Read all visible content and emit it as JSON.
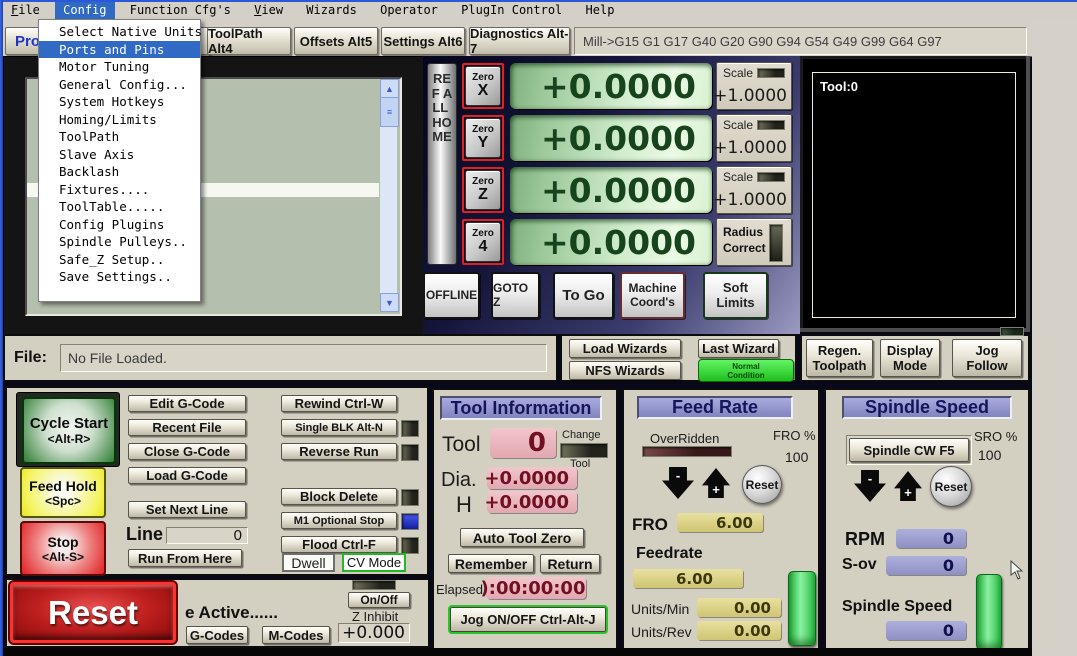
{
  "menubar": {
    "items": [
      "File",
      "Config",
      "Function Cfg's",
      "View",
      "Wizards",
      "Operator",
      "PlugIn Control",
      "Help"
    ]
  },
  "config_menu": {
    "highlighted_item": "Ports and Pins",
    "items": [
      "Select Native Units",
      "Ports and Pins",
      "Motor Tuning",
      "General Config...",
      "System Hotkeys",
      "Homing/Limits",
      "ToolPath",
      "Slave Axis",
      "Backlash",
      "Fixtures....",
      "ToolTable.....",
      "Config Plugins",
      "Spindle Pulleys..",
      "Safe_Z Setup..",
      "Save Settings.."
    ]
  },
  "tabbar": {
    "program_tab": "Prog",
    "toolpath_tab": "ToolPath Alt4",
    "offsets_tab": "Offsets Alt5",
    "settings_tab": "Settings Alt6",
    "diagnostics_tab": "Diagnostics Alt-7",
    "gcode_status": "Mill->G15  G1 G17 G40 G20 G90 G94 G54 G49 G99 G64 G97"
  },
  "toolpath_display": {
    "tool_readout": "Tool:0"
  },
  "dro": {
    "ref_all_home": "REF ALL HOME",
    "zero_label": "Zero",
    "axes": [
      {
        "letter": "X",
        "value": "+0.0000",
        "scale_label": "Scale",
        "scale_value": "+1.0000"
      },
      {
        "letter": "Y",
        "value": "+0.0000",
        "scale_label": "Scale",
        "scale_value": "+1.0000"
      },
      {
        "letter": "Z",
        "value": "+0.0000",
        "scale_label": "Scale",
        "scale_value": "+1.0000"
      },
      {
        "letter": "4",
        "value": "+0.0000"
      }
    ],
    "radius_correct_line1": "Radius",
    "radius_correct_line2": "Correct",
    "offline_btn": "OFFLINE",
    "goto_z_btn": "GOTO Z",
    "to_go_btn": "To Go",
    "machine_coords_line1": "Machine",
    "machine_coords_line2": "Coord's",
    "soft_limits_line1": "Soft",
    "soft_limits_line2": "Limits"
  },
  "file_bar": {
    "label": "File:",
    "filename": "No File Loaded."
  },
  "wizards": {
    "load_btn": "Load Wizards",
    "last_btn": "Last Wizard",
    "nfs_btn": "NFS Wizards",
    "normal_line1": "Normal",
    "normal_line2": "Condition"
  },
  "view_controls": {
    "regen_line1": "Regen.",
    "regen_line2": "Toolpath",
    "display_line1": "Display",
    "display_line2": "Mode",
    "jog_line1": "Jog",
    "jog_line2": "Follow"
  },
  "run_panel": {
    "cycle_start_line1": "Cycle Start",
    "cycle_start_line2": "<Alt-R>",
    "feed_hold_line1": "Feed Hold",
    "feed_hold_line2": "<Spc>",
    "stop_line1": "Stop",
    "stop_line2": "<Alt-S>",
    "edit_gcode": "Edit G-Code",
    "recent_file": "Recent File",
    "close_gcode": "Close G-Code",
    "load_gcode": "Load G-Code",
    "set_next_line": "Set Next Line",
    "line_label": "Line",
    "line_value": "0",
    "run_from_here": "Run From Here",
    "rewind": "Rewind Ctrl-W",
    "single_blk": "Single BLK Alt-N",
    "reverse_run": "Reverse Run",
    "block_delete": "Block Delete",
    "m1_optional_stop": "M1 Optional Stop",
    "flood": "Flood Ctrl-F",
    "dwell": "Dwell",
    "cv_mode": "CV Mode"
  },
  "reset_panel": {
    "reset": "Reset",
    "active_text": "e Active......",
    "gcodes_btn": "G-Codes",
    "mcodes_btn": "M-Codes",
    "onoff_btn": "On/Off",
    "z_inhibit_label": "Z Inhibit",
    "z_inhibit_value": "+0.000"
  },
  "tool_info": {
    "title": "Tool Information",
    "tool_label": "Tool",
    "tool_value": "0",
    "change_label": "Change",
    "tool_sub_label": "Tool",
    "dia_label": "Dia.",
    "dia_value": "+0.0000",
    "h_label": "H",
    "h_value": "+0.0000",
    "auto_tool_zero": "Auto Tool Zero",
    "remember_btn": "Remember",
    "return_btn": "Return",
    "elapsed_label": "Elapsed",
    "elapsed_value": "):00:00:00",
    "jog_btn": "Jog ON/OFF Ctrl-Alt-J"
  },
  "feed_rate": {
    "title": "Feed Rate",
    "overridden_label": "OverRidden",
    "fro_pct_label": "FRO %",
    "fro_pct_value": "100",
    "minus": "-",
    "plus": "+",
    "reset_btn": "Reset",
    "fro_label": "FRO",
    "fro_value": "6.00",
    "feedrate_label": "Feedrate",
    "feedrate_value": "6.00",
    "units_min_label": "Units/Min",
    "units_min_value": "0.00",
    "units_rev_label": "Units/Rev",
    "units_rev_value": "0.00"
  },
  "spindle": {
    "title": "Spindle Speed",
    "cw_btn": "Spindle CW F5",
    "sro_pct_label": "SRO %",
    "sro_pct_value": "100",
    "minus": "-",
    "plus": "+",
    "reset_btn": "Reset",
    "rpm_label": "RPM",
    "rpm_value": "0",
    "sov_label": "S-ov",
    "sov_value": "0",
    "speed_label": "Spindle Speed",
    "speed_value": "0"
  },
  "colors": {
    "menu_highlight": "#316ac5",
    "dro_green": "#cfeccb",
    "dro_text": "#17441c",
    "pink_field": "#ecb7bf",
    "pink_text": "#701022",
    "yellow_field": "#ded58f",
    "lavender_field": "#9b9dcf",
    "panel_title": "#8184bd",
    "normal_condition_green": "#2fd42f",
    "slider_green": "#33cc55",
    "reset_red": "#c01818",
    "led_blue": "#2d3fd4",
    "cycle_start_green": "#2e7d32",
    "feed_hold_yellow": "#f0f040",
    "stop_red": "#e02020"
  }
}
